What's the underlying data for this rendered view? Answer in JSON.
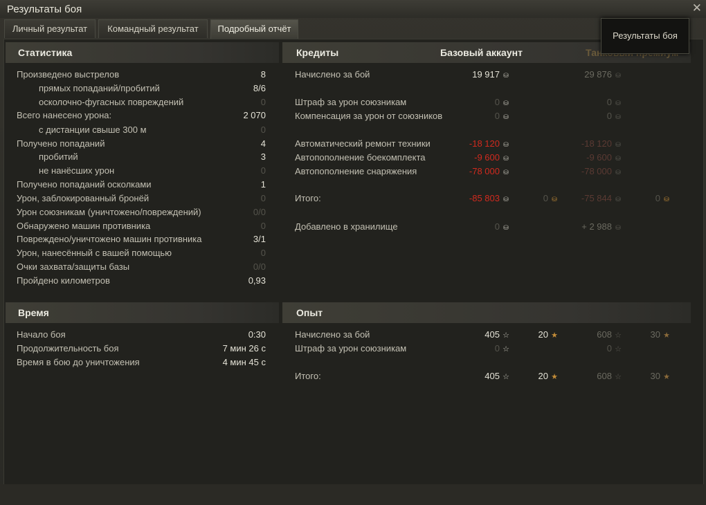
{
  "window": {
    "title": "Результаты боя"
  },
  "tabs": [
    "Личный результат",
    "Командный результат",
    "Подробный отчёт"
  ],
  "tooltip": "Результаты боя",
  "colors": {
    "negative": "#d12a1e",
    "accent": "#c28b37"
  },
  "icons": {
    "credits": "coin-icon",
    "exp": "star-icon",
    "close": "close-icon"
  },
  "statistics": {
    "title": "Статистика",
    "rows": [
      {
        "label": "Произведено выстрелов",
        "value": "8"
      },
      {
        "label": "прямых попаданий/пробитий",
        "value": "8/6"
      },
      {
        "label": "осколочно-фугасных повреждений",
        "value": "0"
      },
      {
        "label": "Всего нанесено урона:",
        "value": "2 070"
      },
      {
        "label": "с дистанции свыше 300 м",
        "value": "0"
      },
      {
        "label": "Получено попаданий",
        "value": "4"
      },
      {
        "label": "пробитий",
        "value": "3"
      },
      {
        "label": "не нанёсших урон",
        "value": "0"
      },
      {
        "label": "Получено попаданий осколками",
        "value": "1"
      },
      {
        "label": "Урон, заблокированный бронёй",
        "value": "0"
      },
      {
        "label": "Урон союзникам (уничтожено/повреждений)",
        "value": "0/0"
      },
      {
        "label": "Обнаружено машин противника",
        "value": "0"
      },
      {
        "label": "Повреждено/уничтожено машин противника",
        "value": "3/1"
      },
      {
        "label": "Урон, нанесённый с вашей помощью",
        "value": "0"
      },
      {
        "label": "Очки захвата/защиты базы",
        "value": "0/0"
      },
      {
        "label": "Пройдено километров",
        "value": "0,93"
      }
    ]
  },
  "time": {
    "title": "Время",
    "rows": [
      {
        "label": "Начало боя",
        "value": "0:30"
      },
      {
        "label": "Продолжительность боя",
        "value": "7 мин 26 с"
      },
      {
        "label": "Время в бою до уничтожения",
        "value": "4 мин 45 с"
      }
    ]
  },
  "credits": {
    "title": "Кредиты",
    "col_base": "Базовый аккаунт",
    "col_premium": "Танковый премиум",
    "rows": [
      {
        "label": "Начислено за бой",
        "base": "19 917",
        "prem": "29 876"
      },
      {
        "label": "Штраф за урон союзникам",
        "base": "0",
        "prem": "0"
      },
      {
        "label": "Компенсация за урон от союзников",
        "base": "0",
        "prem": "0"
      },
      {
        "label": "Автоматический ремонт техники",
        "base": "-18 120",
        "prem": "-18 120"
      },
      {
        "label": "Автопополнение боекомплекта",
        "base": "-9 600",
        "prem": "-9 600"
      },
      {
        "label": "Автопополнение снаряжения",
        "base": "-78 000",
        "prem": "-78 000"
      },
      {
        "label": "Итого:",
        "base": "-85 803",
        "base_gold": "0",
        "prem": "-75 844",
        "prem_gold": "0"
      },
      {
        "label": "Добавлено в хранилище",
        "base": "0",
        "prem": "+ 2 988"
      }
    ]
  },
  "experience": {
    "title": "Опыт",
    "rows": [
      {
        "label": "Начислено за бой",
        "base": "405",
        "base_free": "20",
        "prem": "608",
        "prem_free": "30"
      },
      {
        "label": "Штраф за урон союзникам",
        "base": "0",
        "prem": "0"
      },
      {
        "label": "Итого:",
        "base": "405",
        "base_free": "20",
        "prem": "608",
        "prem_free": "30"
      }
    ]
  }
}
